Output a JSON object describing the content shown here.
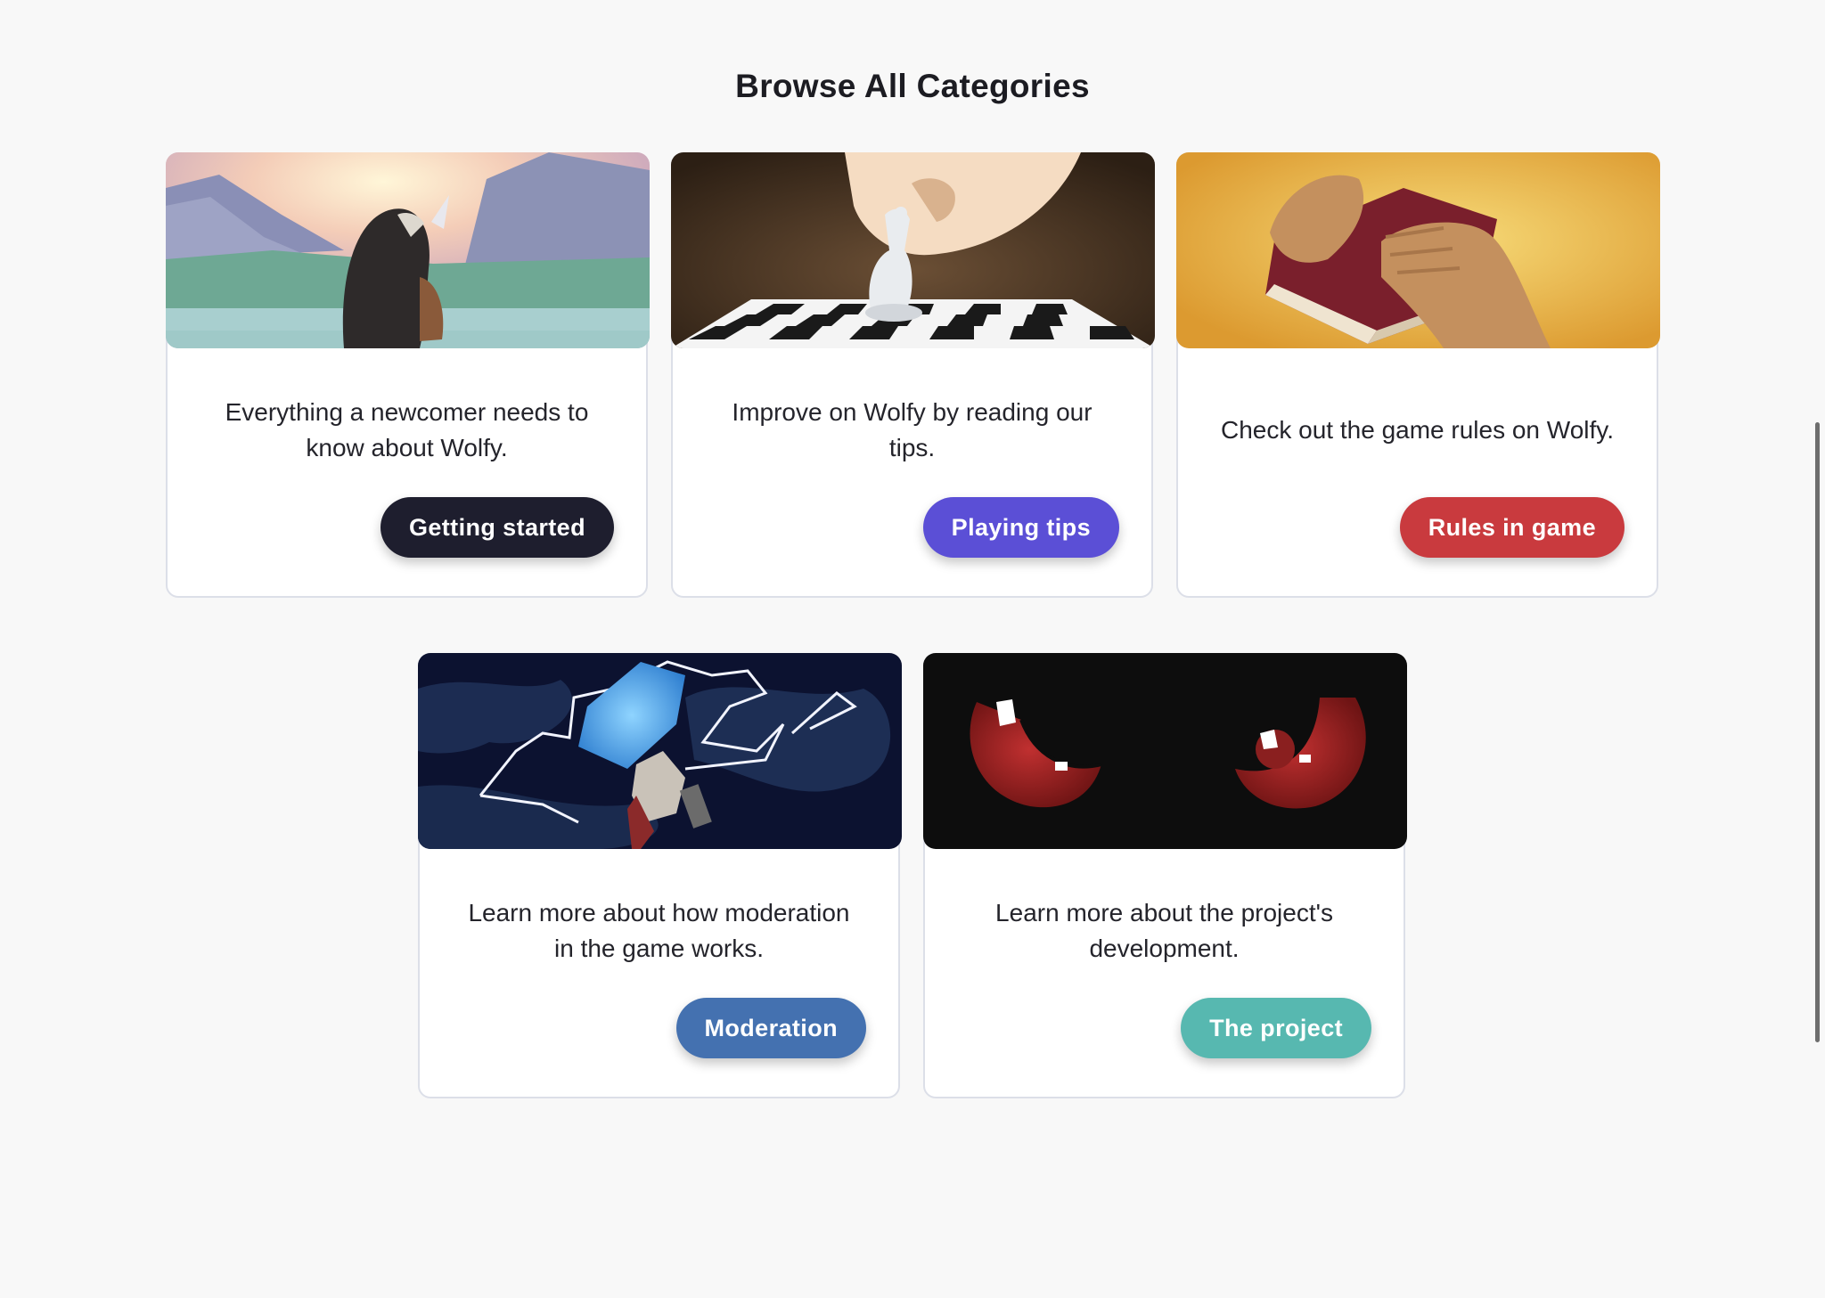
{
  "page": {
    "title": "Browse All Categories"
  },
  "categories": [
    {
      "description": "Everything a newcomer needs to know about Wolfy.",
      "button_label": "Getting started",
      "button_color": "#1e1e2e",
      "banner_icon": "warrior-landscape-illustration"
    },
    {
      "description": "Improve on Wolfy by reading our tips.",
      "button_label": "Playing tips",
      "button_color": "#5b4fd6",
      "banner_icon": "chess-hand-illustration"
    },
    {
      "description": "Check out the game rules on Wolfy.",
      "button_label": "Rules in game",
      "button_color": "#c93a3e",
      "banner_icon": "rule-book-illustration"
    },
    {
      "description": "Learn more about how moderation in the game works.",
      "button_label": "Moderation",
      "button_color": "#4471b0",
      "banner_icon": "lightning-hammer-illustration"
    },
    {
      "description": "Learn more about the project's development.",
      "button_label": "The project",
      "button_color": "#57b8b0",
      "banner_icon": "red-eyes-illustration"
    }
  ]
}
